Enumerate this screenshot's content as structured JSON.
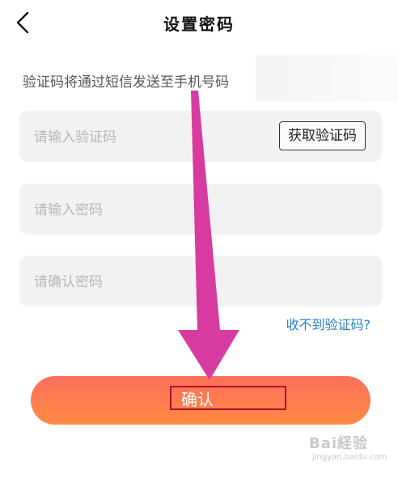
{
  "header": {
    "title": "设置密码",
    "back_icon": "chevron-left-icon"
  },
  "sms_note": "验证码将通过短信发送至手机号码",
  "fields": {
    "verification": {
      "placeholder": "请输入验证码",
      "value": ""
    },
    "get_code_label": "获取验证码",
    "password": {
      "placeholder": "请输入密码",
      "value": ""
    },
    "confirm_password": {
      "placeholder": "请确认密码",
      "value": ""
    }
  },
  "links": {
    "no_code": "收不到验证码?"
  },
  "buttons": {
    "confirm_label": "确认"
  },
  "watermark": {
    "main": "Bai経验",
    "sub": "jingyan.baidu.com"
  },
  "colors": {
    "link": "#2b7fc8",
    "button_top": "#ff6f5b",
    "button_bottom": "#ff8a45",
    "arrow": "#d83ba0",
    "highlight_box": "#b0112a"
  }
}
